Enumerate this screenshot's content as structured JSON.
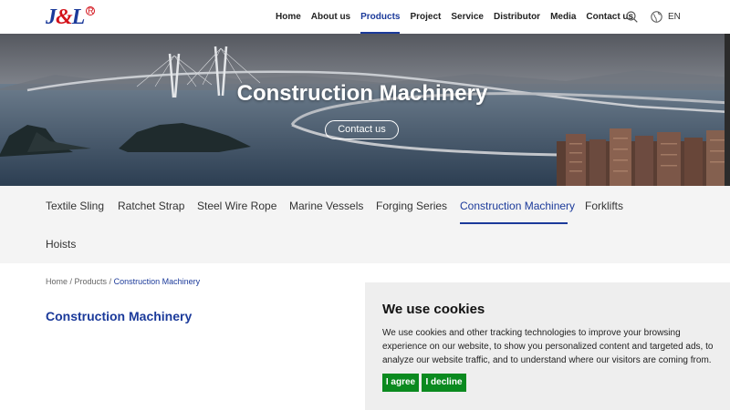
{
  "header": {
    "logo": {
      "main": "J",
      "amp": "&",
      "tail": "L",
      "reg": "R"
    },
    "nav": [
      {
        "label": "Home",
        "active": false
      },
      {
        "label": "About us",
        "active": false
      },
      {
        "label": "Products",
        "active": true
      },
      {
        "label": "Project",
        "active": false
      },
      {
        "label": "Service",
        "active": false
      },
      {
        "label": "Distributor",
        "active": false
      },
      {
        "label": "Media",
        "active": false
      },
      {
        "label": "Contact us",
        "active": false
      }
    ],
    "search_icon": "search-icon",
    "globe_icon": "globe-icon",
    "language": "EN"
  },
  "hero": {
    "title": "Construction Machinery",
    "button_label": "Contact us"
  },
  "categories": [
    {
      "label": "Textile Sling",
      "active": false
    },
    {
      "label": "Ratchet Strap",
      "active": false
    },
    {
      "label": "Steel Wire Rope",
      "active": false
    },
    {
      "label": "Marine Vessels",
      "active": false
    },
    {
      "label": "Forging Series",
      "active": false
    },
    {
      "label": "Construction Machinery",
      "active": true
    },
    {
      "label": "Forklifts",
      "active": false
    },
    {
      "label": "Hoists",
      "active": false
    }
  ],
  "breadcrumb": {
    "home": "Home",
    "sep1": " / ",
    "products": "Products",
    "sep2": " / ",
    "current": "Construction Machinery"
  },
  "page_heading": "Construction Machinery",
  "cookie": {
    "title": "We use cookies",
    "text": "We use cookies and other tracking technologies to improve your browsing experience on our website, to show you personalized content and targeted ads, to analyze our website traffic, and to understand where our visitors are coming from.",
    "agree_label": "I agree",
    "decline_label": "I decline"
  },
  "colors": {
    "brand_blue": "#1b3a9a",
    "brand_red": "#d3121a",
    "accept_green": "#0a8a1f"
  }
}
